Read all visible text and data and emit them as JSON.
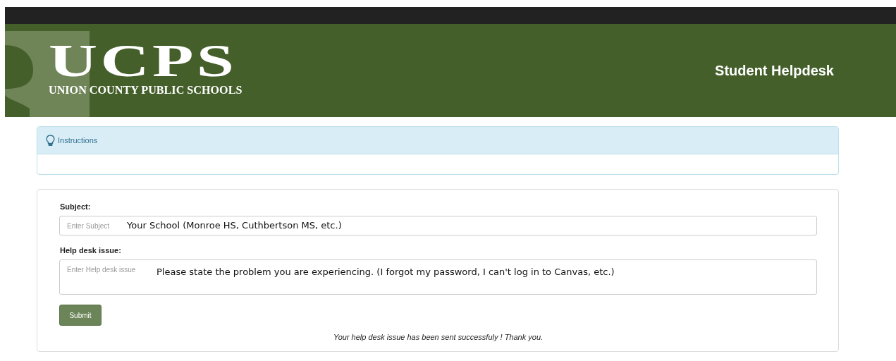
{
  "header": {
    "logo": {
      "title": "UCPS",
      "subtitle": "UNION COUNTY PUBLIC SCHOOLS"
    },
    "page_title": "Student Helpdesk"
  },
  "instructions_panel": {
    "title": "Instructions"
  },
  "form": {
    "fields": [
      {
        "kind": "input",
        "label": "Subject:",
        "placeholder": "Enter Subject",
        "annotation": "Your School (Monroe HS, Cuthbertson MS, etc.)"
      },
      {
        "kind": "textarea",
        "label": "Help desk issue:",
        "placeholder": "Enter Help desk issue",
        "annotation": "Please state the problem you are experiencing. (I forgot my password, I can't log in to Canvas, etc.)"
      }
    ],
    "submit_button": "Submit",
    "confirmation": "Your help desk issue has been sent successfuly ! Thank you."
  }
}
